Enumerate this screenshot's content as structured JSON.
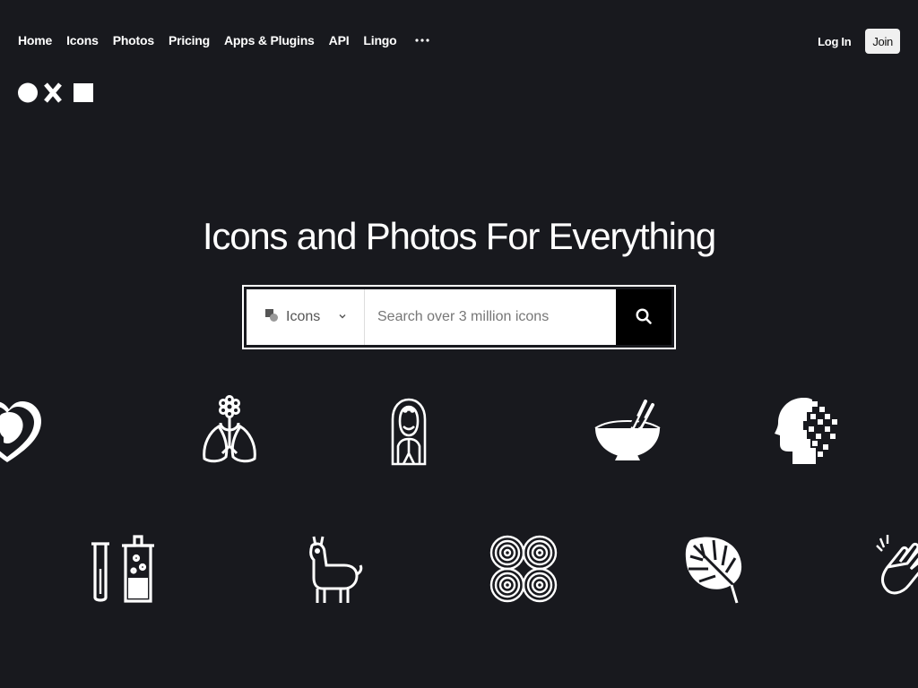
{
  "nav": {
    "links": [
      "Home",
      "Icons",
      "Photos",
      "Pricing",
      "Apps & Plugins",
      "API",
      "Lingo"
    ],
    "login_label": "Log In",
    "join_label": "Join"
  },
  "hero": {
    "title": "Icons and Photos For Everything"
  },
  "search": {
    "type_label": "Icons",
    "placeholder": "Search over 3 million icons"
  },
  "icons": [
    "heart-face-icon",
    "flower-lungs-icon",
    "woman-portrait-icon",
    "bowl-chopsticks-icon",
    "pixel-head-icon",
    "test-tube-bottle-icon",
    "llama-icon",
    "spiral-knot-icon",
    "monstera-leaf-icon",
    "clapping-hands-icon"
  ],
  "colors": {
    "background": "#18191e",
    "text": "#ffffff",
    "search_button": "#000000"
  }
}
